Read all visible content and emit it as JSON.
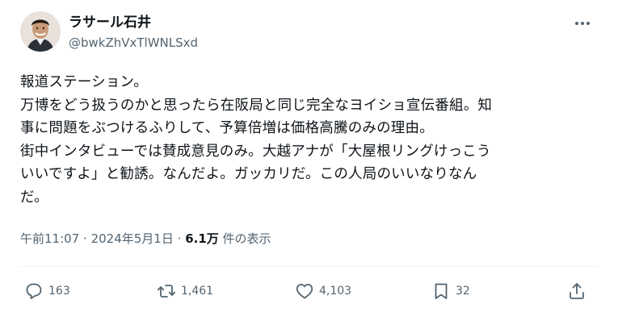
{
  "author": {
    "name": "ラサール石井",
    "handle": "@bwkZhVxTlWNLSxd"
  },
  "tweet": {
    "text": "報道ステーション。\n万博をどう扱うのかと思ったら在阪局と同じ完全なヨイショ宣伝番組。知\n事に問題をぶつけるふりして、予算倍増は価格高騰のみの理由。\n街中インタビューでは賛成意見のみ。大越アナが「大屋根リングけっこう\nいいですよ」と勧誘。なんだよ。ガッカリだ。この人局のいいなりなん\nだ。"
  },
  "meta": {
    "time": "午前11:07",
    "separator": "·",
    "date": "2024年5月1日",
    "views_count": "6.1万",
    "views_label": "件の表示"
  },
  "actions": {
    "replies": "163",
    "reposts": "1,461",
    "likes": "4,103",
    "bookmarks": "32"
  },
  "icons": {
    "more": "more-horizontal-icon",
    "reply": "reply-icon",
    "repost": "repost-icon",
    "like": "heart-icon",
    "bookmark": "bookmark-icon",
    "share": "share-icon"
  },
  "colors": {
    "text": "#0f1419",
    "secondary": "#536471",
    "divider": "#eff3f4"
  }
}
